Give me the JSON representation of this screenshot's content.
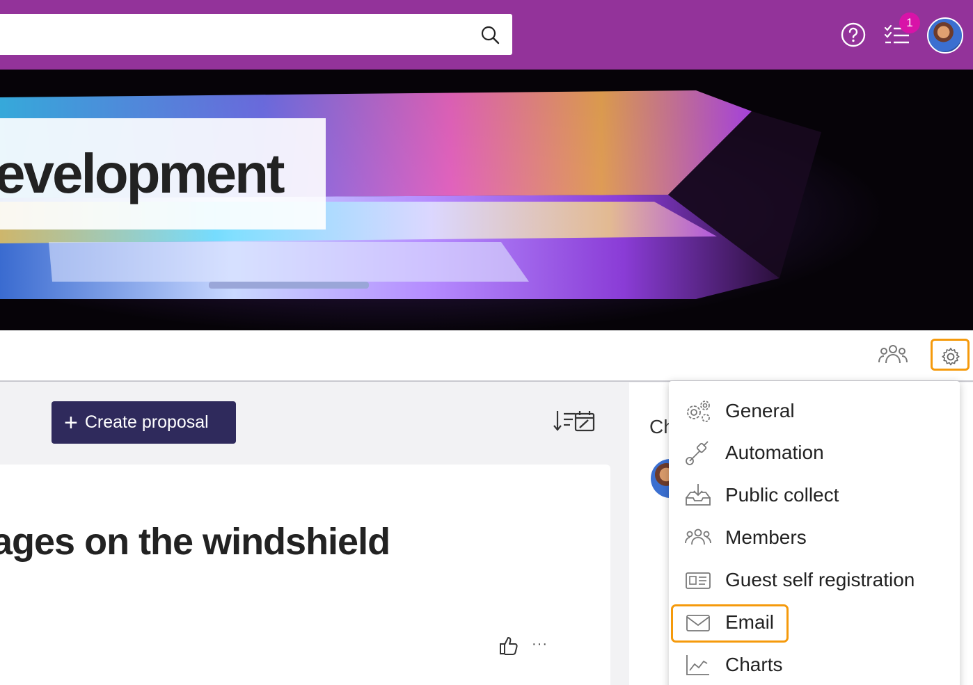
{
  "header": {
    "help_icon": "help-circle-icon",
    "tasks_icon": "checklist-icon",
    "tasks_badge": "1"
  },
  "banner": {
    "title": "evelopment"
  },
  "toolbar": {
    "members_icon": "group-icon",
    "settings_icon": "gear-icon",
    "highlight_color": "#f59a0c"
  },
  "main": {
    "create_button_label": "Create proposal",
    "card_title": "ages on the windshield"
  },
  "right_column": {
    "heading": "Ch"
  },
  "settings_menu": {
    "items": [
      {
        "label": "General",
        "icon": "gears-icon"
      },
      {
        "label": "Automation",
        "icon": "pipe-icon"
      },
      {
        "label": "Public collect",
        "icon": "inbox-download-icon"
      },
      {
        "label": "Members",
        "icon": "group-icon"
      },
      {
        "label": "Guest self registration",
        "icon": "id-card-icon"
      },
      {
        "label": "Email",
        "icon": "envelope-icon"
      },
      {
        "label": "Charts",
        "icon": "chart-line-icon"
      }
    ]
  },
  "colors": {
    "topbar": "#93339a",
    "primary_button": "#2f2a5c",
    "badge": "#d813a8"
  }
}
